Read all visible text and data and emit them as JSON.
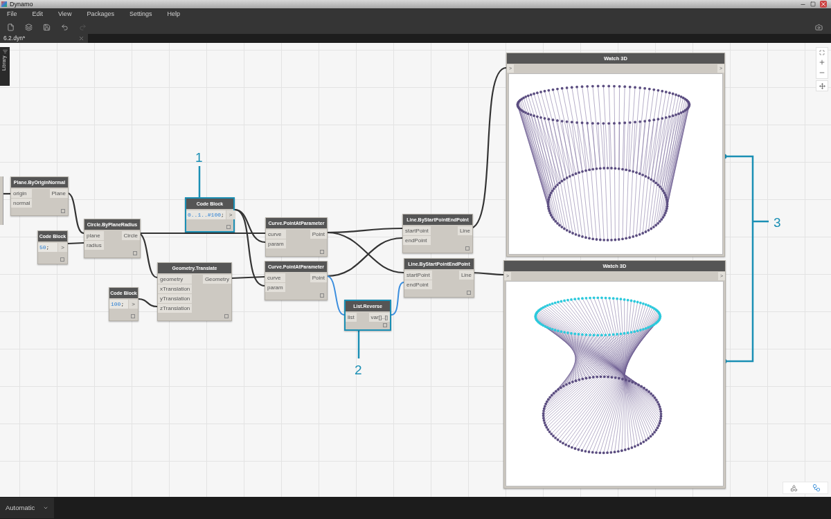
{
  "window": {
    "title": "Dynamo"
  },
  "menu": [
    {
      "label": "File"
    },
    {
      "label": "Edit"
    },
    {
      "label": "View"
    },
    {
      "label": "Packages"
    },
    {
      "label": "Settings"
    },
    {
      "label": "Help"
    }
  ],
  "tab": {
    "label": "6.2.dyn*"
  },
  "library_tab": {
    "label": "Library"
  },
  "nodes": [
    {
      "kind": "function",
      "title": "Plane.ByOriginNormal",
      "inputs": [
        "origin",
        "normal"
      ],
      "outputs": [
        "Plane"
      ],
      "selected": false
    },
    {
      "kind": "code",
      "title": "Code Block",
      "code": "50;",
      "output": ">",
      "selected": false
    },
    {
      "kind": "function",
      "title": "Circle.ByPlaneRadius",
      "inputs": [
        "plane",
        "radius"
      ],
      "outputs": [
        "Circle"
      ],
      "selected": false
    },
    {
      "kind": "code",
      "title": "Code Block",
      "code": "0..1..#100;",
      "output": ">",
      "selected": true
    },
    {
      "kind": "function",
      "title": "Geometry.Translate",
      "inputs": [
        "geometry",
        "xTranslation",
        "yTranslation",
        "zTranslation"
      ],
      "outputs": [
        "Geometry"
      ],
      "selected": false
    },
    {
      "kind": "code",
      "title": "Code Block",
      "code": "100;",
      "output": ">",
      "selected": false
    },
    {
      "kind": "function",
      "title": "Curve.PointAtParameter",
      "inputs": [
        "curve",
        "param"
      ],
      "outputs": [
        "Point"
      ],
      "selected": false
    },
    {
      "kind": "function",
      "title": "Curve.PointAtParameter",
      "inputs": [
        "curve",
        "param"
      ],
      "outputs": [
        "Point"
      ],
      "selected": false
    },
    {
      "kind": "function",
      "title": "Line.ByStartPointEndPoint",
      "inputs": [
        "startPoint",
        "endPoint"
      ],
      "outputs": [
        "Line"
      ],
      "selected": false
    },
    {
      "kind": "function",
      "title": "Line.ByStartPointEndPoint",
      "inputs": [
        "startPoint",
        "endPoint"
      ],
      "outputs": [
        "Line"
      ],
      "selected": false
    },
    {
      "kind": "function",
      "title": "List.Reverse",
      "inputs": [
        "list"
      ],
      "outputs": [
        "var[]..[]"
      ],
      "selected": true
    }
  ],
  "watch_nodes": [
    {
      "title": "Watch 3D",
      "input": ">",
      "output": ">",
      "kind": "straight",
      "highlighted": false
    },
    {
      "title": "Watch 3D",
      "input": ">",
      "output": ">",
      "kind": "twisted",
      "highlighted": true
    }
  ],
  "annotations": [
    {
      "label": "1"
    },
    {
      "label": "2"
    },
    {
      "label": "3"
    }
  ],
  "run_mode": {
    "value": "Automatic"
  }
}
